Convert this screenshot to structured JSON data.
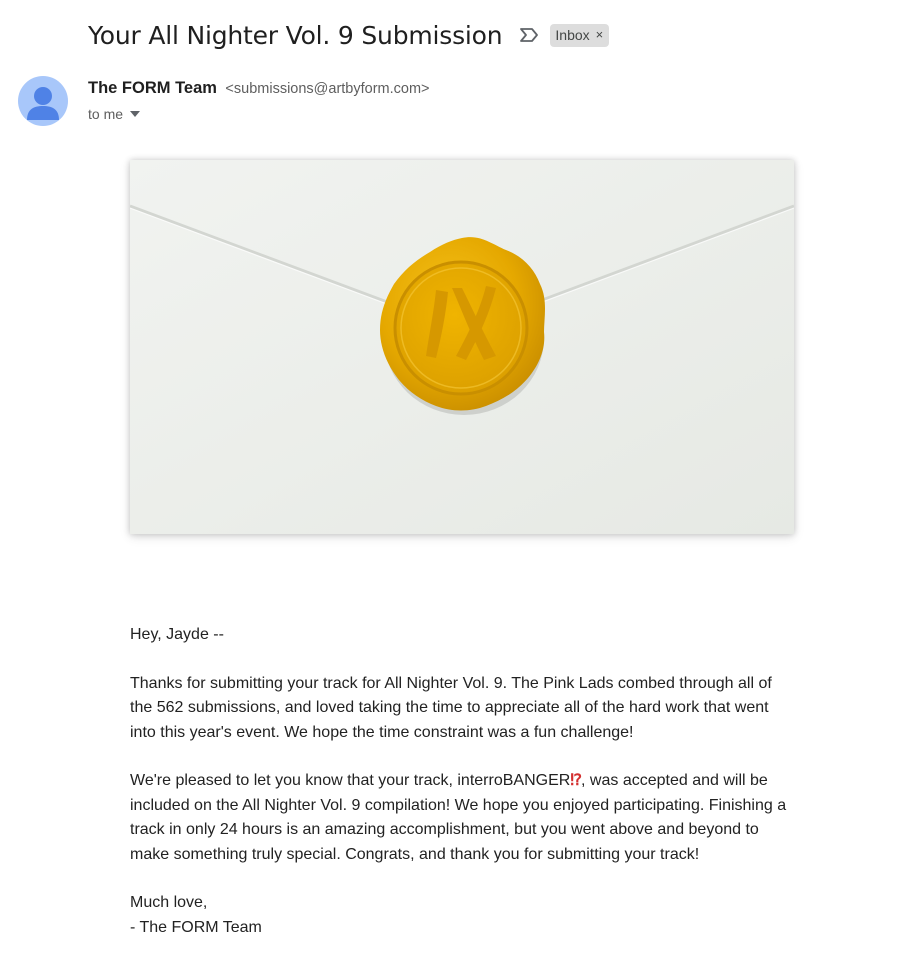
{
  "email": {
    "subject": "Your All Nighter Vol. 9 Submission",
    "labels": [
      {
        "name": "Inbox",
        "close_glyph": "×"
      }
    ],
    "icons": {
      "important": "important-marker-icon",
      "avatar": "person-avatar-icon",
      "recipient_toggle": "chevron-down-icon"
    },
    "sender": {
      "name": "The FORM Team",
      "email": "<submissions@artbyform.com>"
    },
    "recipient": "to me",
    "banner": {
      "seal_monogram": "IX",
      "seal_color": "#e5a800"
    },
    "body": {
      "greeting": "Hey, Jayde --",
      "paragraph1": "Thanks for submitting your track for All Nighter Vol. 9. The Pink Lads combed through all of the 562 submissions, and loved taking the time to appreciate all of the hard work that went into this year's event. We hope the time constraint was a fun challenge!",
      "paragraph2_before": "We're pleased to let you know that your track, interroBANGER",
      "paragraph2_emoji": "⁉",
      "paragraph2_after": ", was accepted and will be included on the All Nighter Vol. 9 compilation! We hope you enjoyed participating. Finishing a track in only 24 hours is an amazing accomplishment, but you went above and beyond to make something truly special. Congrats, and thank you for submitting your track!",
      "signoff": "Much love,",
      "signature": "- The FORM Team"
    }
  }
}
